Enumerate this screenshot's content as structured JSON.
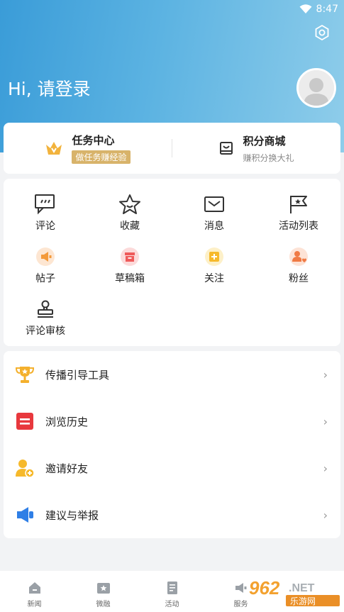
{
  "status": {
    "time": "8:47"
  },
  "header": {
    "greeting": "Hi, 请登录"
  },
  "task_card": {
    "task_center": {
      "title": "任务中心",
      "badge": "做任务赚经验"
    },
    "points_mall": {
      "title": "积分商城",
      "subtitle": "赚积分换大礼"
    }
  },
  "grid": {
    "items": [
      {
        "label": "评论",
        "icon": "comment-icon"
      },
      {
        "label": "收藏",
        "icon": "star-icon"
      },
      {
        "label": "消息",
        "icon": "envelope-icon"
      },
      {
        "label": "活动列表",
        "icon": "flag-icon"
      },
      {
        "label": "帖子",
        "icon": "megaphone-icon"
      },
      {
        "label": "草稿箱",
        "icon": "draft-box-icon"
      },
      {
        "label": "关注",
        "icon": "follow-plus-icon"
      },
      {
        "label": "粉丝",
        "icon": "fans-icon"
      },
      {
        "label": "评论审核",
        "icon": "stamp-icon"
      }
    ]
  },
  "list": {
    "items": [
      {
        "label": "传播引导工具",
        "icon": "trophy-icon"
      },
      {
        "label": "浏览历史",
        "icon": "history-icon"
      },
      {
        "label": "邀请好友",
        "icon": "invite-friend-icon"
      },
      {
        "label": "建议与举报",
        "icon": "feedback-icon"
      }
    ]
  },
  "bottom_nav": {
    "items": [
      {
        "label": "新闻",
        "icon": "home-icon"
      },
      {
        "label": "微融",
        "icon": "star-box-icon"
      },
      {
        "label": "活动",
        "icon": "clipboard-icon"
      },
      {
        "label": "服务",
        "icon": "service-icon"
      }
    ]
  },
  "colors": {
    "header_start": "#3a9cd8",
    "header_end": "#8fcdea",
    "badge": "#d8b36a",
    "accent_orange": "#f4a742"
  }
}
